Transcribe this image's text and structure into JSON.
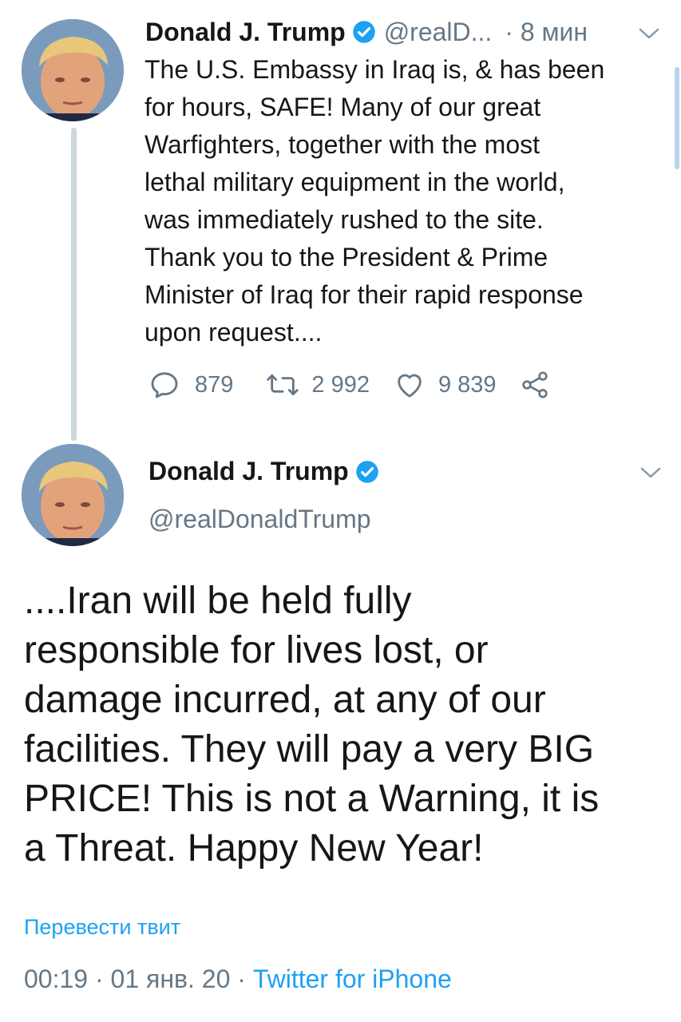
{
  "colors": {
    "text": "#14171a",
    "secondary": "#657786",
    "link": "#1da1f2",
    "thread_line": "#ccd6dd"
  },
  "tweet1": {
    "name": "Donald J. Trump",
    "handle": "@realD...",
    "time": "· 8 мин",
    "text": "The U.S. Embassy in Iraq is, & has been\nfor hours, SAFE! Many of our great\nWarfighters, together with the most\nlethal military equipment in the world,\nwas immediately rushed to the site.\nThank you to the President & Prime\nMinister of Iraq for their rapid response\nupon request....",
    "replies": "879",
    "retweets": "2 992",
    "likes": "9 839",
    "icons": {
      "reply": "reply-icon",
      "retweet": "retweet-icon",
      "like": "heart-icon",
      "share": "share-icon",
      "verified": "verified-badge-icon",
      "menu": "chevron-down-icon"
    }
  },
  "tweet2": {
    "name": "Donald J. Trump",
    "handle": "@realDonaldTrump",
    "text": "....Iran will be held fully\nresponsible for lives lost, or\ndamage incurred, at any of our\nfacilities. They will pay a very BIG\nPRICE! This is not a Warning, it is\na Threat. Happy New Year!",
    "translate_label": "Перевести твит",
    "timestamp": "00:19 · 01 янв. 20 · ",
    "source": "Twitter for iPhone"
  }
}
